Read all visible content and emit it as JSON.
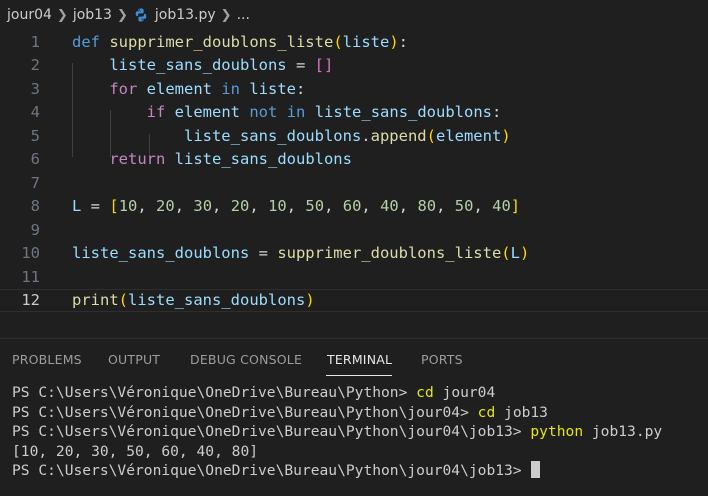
{
  "breadcrumb": {
    "items": [
      "jour04",
      "job13",
      "job13.py",
      "..."
    ],
    "file_icon": "python-icon"
  },
  "editor": {
    "active_line": 12,
    "line_numbers": [
      "1",
      "2",
      "3",
      "4",
      "5",
      "6",
      "7",
      "8",
      "9",
      "10",
      "11",
      "12"
    ],
    "lines": [
      [
        [
          "kw",
          "def"
        ],
        [
          "op",
          " "
        ],
        [
          "fn",
          "supprimer_doublons_liste"
        ],
        [
          "br1",
          "("
        ],
        [
          "var",
          "liste"
        ],
        [
          "br1",
          ")"
        ],
        [
          "op",
          ":"
        ]
      ],
      [
        [
          "op",
          "    "
        ],
        [
          "var",
          "liste_sans_doublons"
        ],
        [
          "op",
          " = "
        ],
        [
          "br2",
          "[]"
        ]
      ],
      [
        [
          "op",
          "    "
        ],
        [
          "ctl",
          "for"
        ],
        [
          "op",
          " "
        ],
        [
          "var",
          "element"
        ],
        [
          "op",
          " "
        ],
        [
          "kw",
          "in"
        ],
        [
          "op",
          " "
        ],
        [
          "var",
          "liste"
        ],
        [
          "op",
          ":"
        ]
      ],
      [
        [
          "op",
          "        "
        ],
        [
          "ctl",
          "if"
        ],
        [
          "op",
          " "
        ],
        [
          "var",
          "element"
        ],
        [
          "op",
          " "
        ],
        [
          "kw",
          "not"
        ],
        [
          "op",
          " "
        ],
        [
          "kw",
          "in"
        ],
        [
          "op",
          " "
        ],
        [
          "var",
          "liste_sans_doublons"
        ],
        [
          "op",
          ":"
        ]
      ],
      [
        [
          "op",
          "            "
        ],
        [
          "var",
          "liste_sans_doublons"
        ],
        [
          "op",
          "."
        ],
        [
          "fn",
          "append"
        ],
        [
          "br1",
          "("
        ],
        [
          "var",
          "element"
        ],
        [
          "br1",
          ")"
        ]
      ],
      [
        [
          "op",
          "    "
        ],
        [
          "ctl",
          "return"
        ],
        [
          "op",
          " "
        ],
        [
          "var",
          "liste_sans_doublons"
        ]
      ],
      [],
      [
        [
          "var",
          "L"
        ],
        [
          "op",
          " = "
        ],
        [
          "br1",
          "["
        ],
        [
          "num",
          "10"
        ],
        [
          "op",
          ", "
        ],
        [
          "num",
          "20"
        ],
        [
          "op",
          ", "
        ],
        [
          "num",
          "30"
        ],
        [
          "op",
          ", "
        ],
        [
          "num",
          "20"
        ],
        [
          "op",
          ", "
        ],
        [
          "num",
          "10"
        ],
        [
          "op",
          ", "
        ],
        [
          "num",
          "50"
        ],
        [
          "op",
          ", "
        ],
        [
          "num",
          "60"
        ],
        [
          "op",
          ", "
        ],
        [
          "num",
          "40"
        ],
        [
          "op",
          ", "
        ],
        [
          "num",
          "80"
        ],
        [
          "op",
          ", "
        ],
        [
          "num",
          "50"
        ],
        [
          "op",
          ", "
        ],
        [
          "num",
          "40"
        ],
        [
          "br1",
          "]"
        ]
      ],
      [],
      [
        [
          "var",
          "liste_sans_doublons"
        ],
        [
          "op",
          " = "
        ],
        [
          "fn",
          "supprimer_doublons_liste"
        ],
        [
          "br1",
          "("
        ],
        [
          "var",
          "L"
        ],
        [
          "br1",
          ")"
        ]
      ],
      [],
      [
        [
          "fn",
          "print"
        ],
        [
          "br1",
          "("
        ],
        [
          "var",
          "liste_sans_doublons"
        ],
        [
          "br1",
          ")"
        ]
      ]
    ]
  },
  "panel": {
    "tabs": [
      "PROBLEMS",
      "OUTPUT",
      "DEBUG CONSOLE",
      "TERMINAL",
      "PORTS"
    ],
    "active_tab": "TERMINAL"
  },
  "terminal": {
    "lines": [
      {
        "prompt": "PS C:\\Users\\Véronique\\OneDrive\\Bureau\\Python> ",
        "cmd": "cd",
        "args": " jour04"
      },
      {
        "prompt": "PS C:\\Users\\Véronique\\OneDrive\\Bureau\\Python\\jour04> ",
        "cmd": "cd",
        "args": " job13"
      },
      {
        "prompt": "PS C:\\Users\\Véronique\\OneDrive\\Bureau\\Python\\jour04\\job13> ",
        "cmd": "python",
        "args": " job13.py"
      },
      {
        "output": "[10, 20, 30, 50, 60, 40, 80]"
      },
      {
        "prompt": "PS C:\\Users\\Véronique\\OneDrive\\Bureau\\Python\\jour04\\job13> ",
        "cursor": true
      }
    ]
  }
}
